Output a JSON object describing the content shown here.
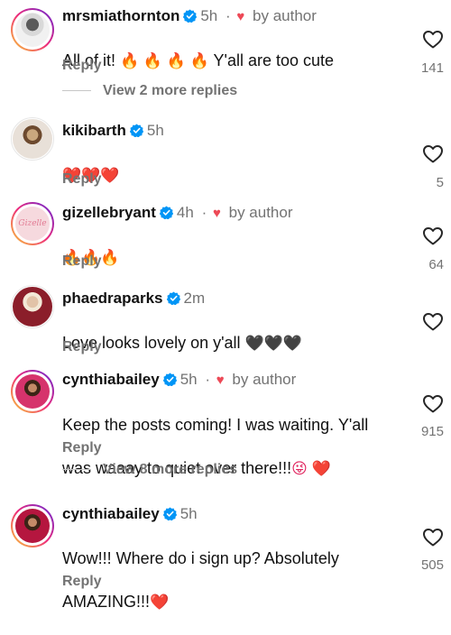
{
  "icons": {
    "verified": "verified-badge-icon",
    "like": "heart-outline-icon",
    "author_like": "red-heart-icon"
  },
  "colors": {
    "verified": "#0095f6",
    "author_heart": "#ed4956",
    "meta": "#737373"
  },
  "comments": [
    {
      "username": "mrsmiathornton",
      "time": "5h",
      "separator": "·",
      "author_label": "by author",
      "text_parts": [
        "All of it! ",
        "🔥 🔥 🔥 🔥",
        " Y'all are too cute"
      ],
      "reply_label": "Reply",
      "likes": "141",
      "view_replies": "View 2 more replies"
    },
    {
      "username": "kikibarth",
      "time": "5h",
      "text_parts": [
        "❤️❤️❤️"
      ],
      "reply_label": "Reply",
      "likes": "5"
    },
    {
      "username": "gizellebryant",
      "time": "4h",
      "separator": "·",
      "author_label": "by author",
      "avatar_text": "Gizelle",
      "text_parts": [
        "🔥🔥🔥"
      ],
      "reply_label": "Reply",
      "likes": "64"
    },
    {
      "username": "phaedraparks",
      "time": "2m",
      "text_parts": [
        "Love looks lovely on y'all ",
        "🖤🖤🖤"
      ],
      "reply_label": "Reply"
    },
    {
      "username": "cynthiabailey",
      "time": "5h",
      "separator": "·",
      "author_label": "by author",
      "text_line1": "Keep the posts coming! I was waiting. Y'all",
      "text_line2": "was waaay to quiet over there!!!",
      "text_emoji": "😜 ❤️",
      "reply_label": "Reply",
      "likes": "915",
      "view_replies": "View 8 more replies"
    },
    {
      "username": "cynthiabailey",
      "time": "5h",
      "text_line1": "Wow!!! Where do i sign up? Absolutely",
      "text_line2": "AMAZING!!!",
      "text_emoji": "❤️",
      "reply_label": "Reply",
      "likes": "505"
    }
  ]
}
